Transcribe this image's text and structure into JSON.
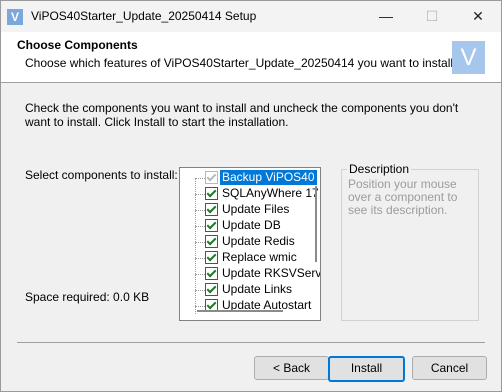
{
  "window": {
    "title": "ViPOS40Starter_Update_20250414 Setup",
    "app_icon_letter": "V",
    "minimize_glyph": "—",
    "maximize_glyph": "☐",
    "close_glyph": "✕"
  },
  "header": {
    "title": "Choose Components",
    "subtitle": "Choose which features of ViPOS40Starter_Update_20250414 you want to install.",
    "logo_letter": "V"
  },
  "intro_text": "Check the components you want to install and uncheck the components you don't want to install. Click Install to start the installation.",
  "select_label": "Select components to install:",
  "components": [
    {
      "label": "Backup ViPOS40",
      "checked": true,
      "disabled": true,
      "selected": true
    },
    {
      "label": "SQLAnyWhere 17",
      "checked": true
    },
    {
      "label": "Update Files",
      "checked": true
    },
    {
      "label": "Update DB",
      "checked": true
    },
    {
      "label": "Update Redis",
      "checked": true
    },
    {
      "label": "Replace wmic",
      "checked": true
    },
    {
      "label": "Update RKSVServi",
      "checked": true
    },
    {
      "label": "Update Links",
      "checked": true
    },
    {
      "label": "Update Autostart",
      "checked": true
    }
  ],
  "description": {
    "title": "Description",
    "text": "Position your mouse over a component to see its description."
  },
  "space_required": "Space required: 0.0 KB",
  "buttons": {
    "back": "< Back",
    "install": "Install",
    "cancel": "Cancel"
  },
  "colors": {
    "accent": "#0078d7",
    "checkmark": "#1e7a1e",
    "logo_bg": "#a7c6ec"
  }
}
